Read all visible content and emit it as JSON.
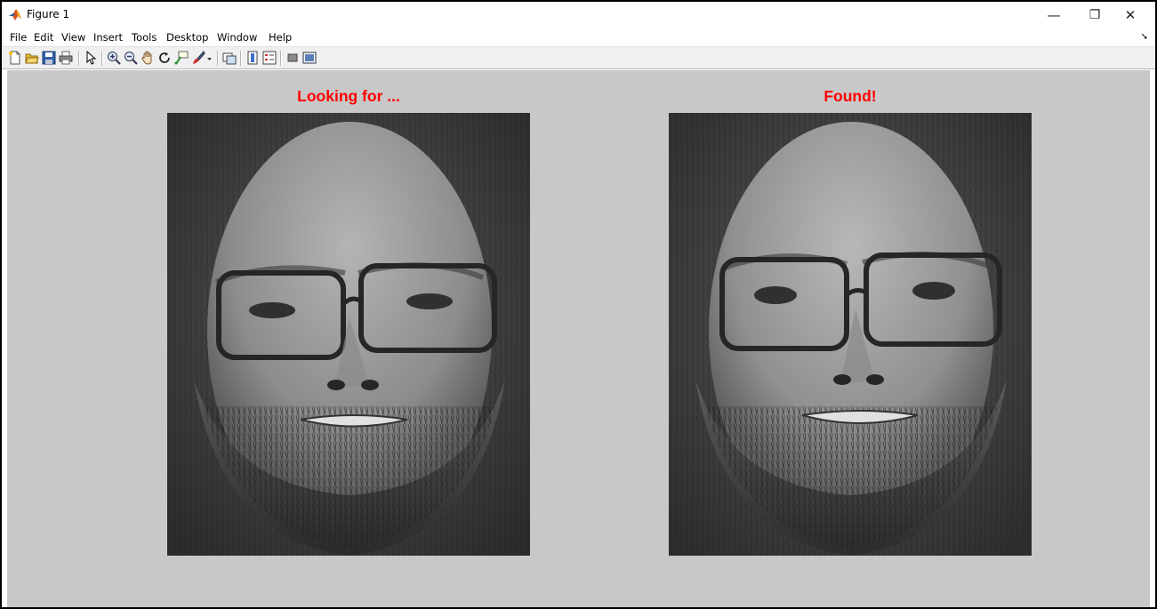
{
  "window": {
    "title": "Figure 1",
    "controls": {
      "minimize": "—",
      "restore": "❐",
      "close": "✕"
    }
  },
  "menubar": {
    "items": [
      "File",
      "Edit",
      "View",
      "Insert",
      "Tools",
      "Desktop",
      "Window",
      "Help"
    ],
    "overflow_arrow": "➘"
  },
  "toolbar": {
    "icons": [
      "new-figure-icon",
      "open-file-icon",
      "save-icon",
      "print-icon",
      "pointer-icon",
      "zoom-in-icon",
      "zoom-out-icon",
      "pan-hand-icon",
      "rotate-3d-icon",
      "data-cursor-icon",
      "brush-icon",
      "brush-dropdown-icon",
      "link-plot-icon",
      "colorbar-icon",
      "legend-icon",
      "hide-plot-tools-icon",
      "show-plot-tools-icon"
    ]
  },
  "figure": {
    "background": "#c8c8c8",
    "title_color": "#ff0000",
    "axes": [
      {
        "title": "Looking for ...",
        "image": "grayscale face photograph - bald man with glasses and beard (query)"
      },
      {
        "title": "Found!",
        "image": "grayscale face photograph - bald man with glasses and beard (match)"
      }
    ]
  }
}
